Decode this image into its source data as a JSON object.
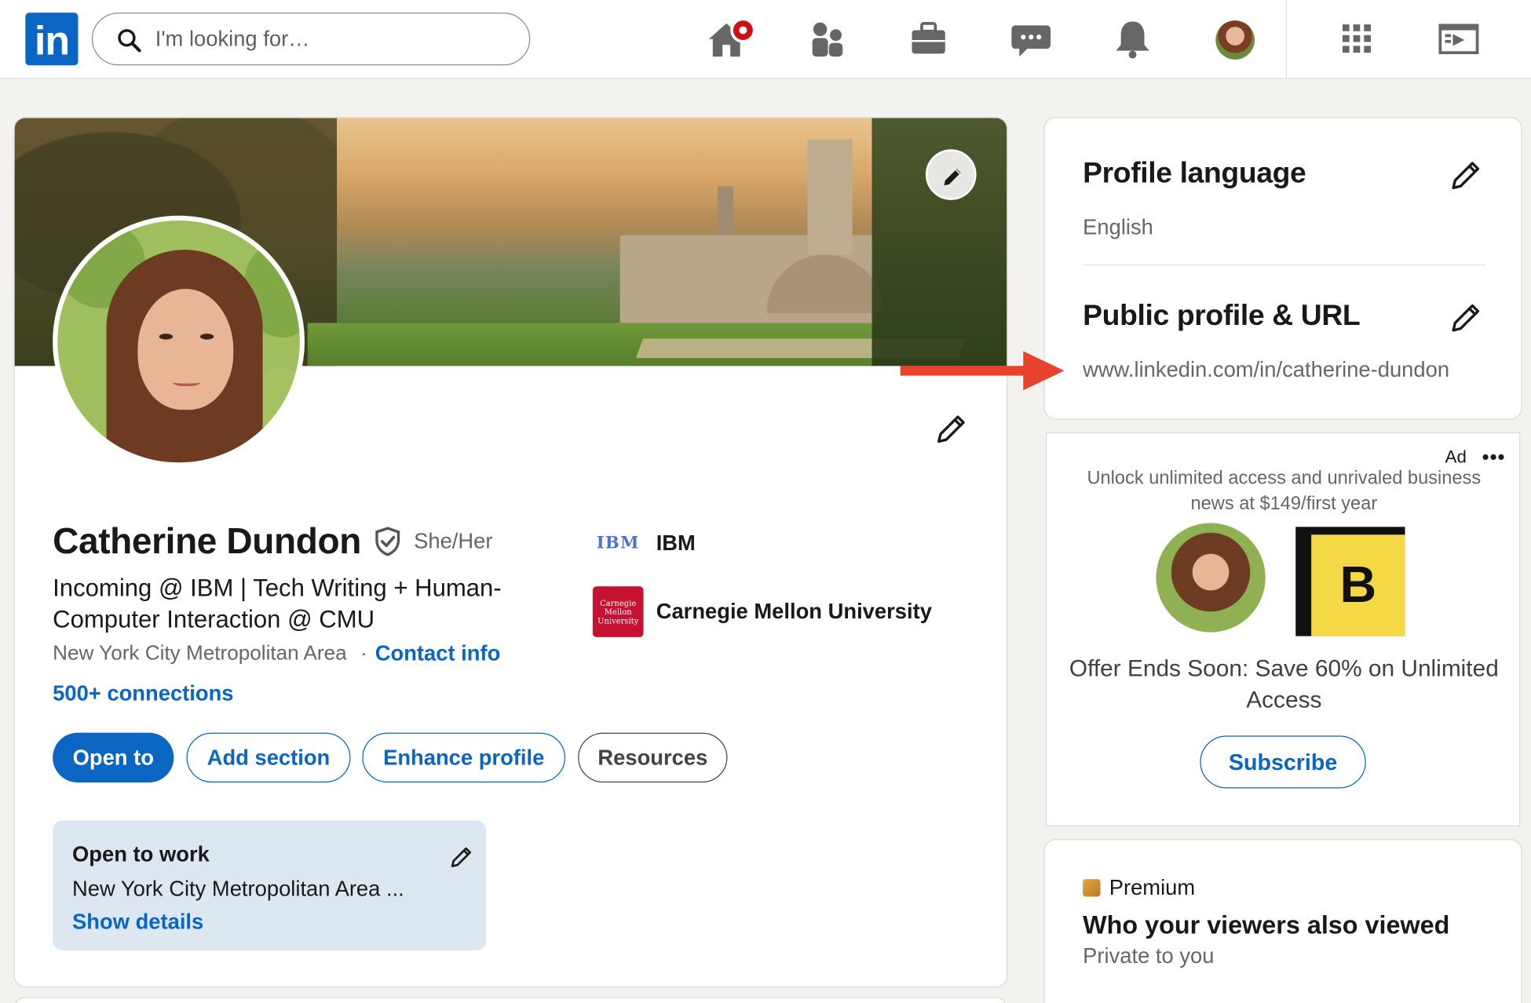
{
  "nav": {
    "logo_text": "in",
    "search_placeholder": "I'm looking for…",
    "icons": [
      "home-icon",
      "my-network-icon",
      "jobs-icon",
      "messaging-icon",
      "notifications-icon",
      "me-avatar",
      "work-grid-icon",
      "learning-icon"
    ]
  },
  "profile": {
    "name": "Catherine Dundon",
    "pronouns": "She/Her",
    "headline": "Incoming @ IBM | Tech Writing + Human-Computer Interaction @ CMU",
    "location": "New York City Metropolitan Area",
    "contact_info": "Contact info",
    "connections": "500+ connections",
    "companies": [
      {
        "logo": "IBM",
        "name": "IBM"
      },
      {
        "logo": "Carnegie Mellon University",
        "name": "Carnegie Mellon University"
      }
    ],
    "buttons": {
      "open_to": "Open to",
      "add_section": "Add section",
      "enhance_profile": "Enhance profile",
      "resources": "Resources"
    },
    "open_to_work": {
      "title": "Open to work",
      "location": "New York City Metropolitan Area ...",
      "show_details": "Show details"
    }
  },
  "sidebar": {
    "profile_language": {
      "title": "Profile language",
      "value": "English"
    },
    "public_profile": {
      "title": "Public profile & URL",
      "value": "www.linkedin.com/in/catherine-dundon"
    },
    "ad": {
      "label": "Ad",
      "more": "•••",
      "text": "Unlock unlimited access and unrivaled business news at $149/first year",
      "brand_letter": "B",
      "offer": "Offer Ends Soon: Save 60% on Unlimited Access",
      "subscribe": "Subscribe"
    },
    "premium": {
      "label": "Premium",
      "title": "Who your viewers also viewed",
      "subtitle": "Private to you"
    }
  },
  "colors": {
    "brand_blue": "#0a66c2",
    "annotation_arrow": "#e8432d",
    "notification_red": "#cc1016"
  }
}
